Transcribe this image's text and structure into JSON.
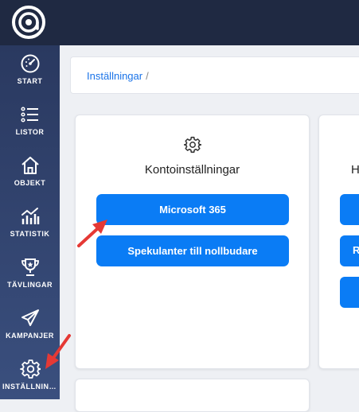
{
  "sidebar": {
    "items": [
      {
        "label": "START",
        "icon": "gauge-icon"
      },
      {
        "label": "LISTOR",
        "icon": "list-icon"
      },
      {
        "label": "OBJEKT",
        "icon": "house-icon"
      },
      {
        "label": "STATISTIK",
        "icon": "chart-icon"
      },
      {
        "label": "TÄVLINGAR",
        "icon": "trophy-icon"
      },
      {
        "label": "KAMPANJER",
        "icon": "paper-plane-icon"
      },
      {
        "label": "INSTÄLLNINGAR",
        "icon": "gear-icon"
      }
    ]
  },
  "breadcrumb": {
    "current": "Inställningar",
    "separator": "/"
  },
  "cards": {
    "account": {
      "icon": "gear-icon",
      "title": "Kontoinställningar",
      "buttons": [
        "Microsoft 365",
        "Spekulanter till nollbudare"
      ]
    },
    "second": {
      "title_partial": "H",
      "button_partials": [
        "",
        "R",
        ""
      ]
    }
  },
  "colors": {
    "accent": "#0a7cf5",
    "topbar": "#1f2942",
    "sidebar": "#2f416b",
    "arrow": "#e53935"
  }
}
